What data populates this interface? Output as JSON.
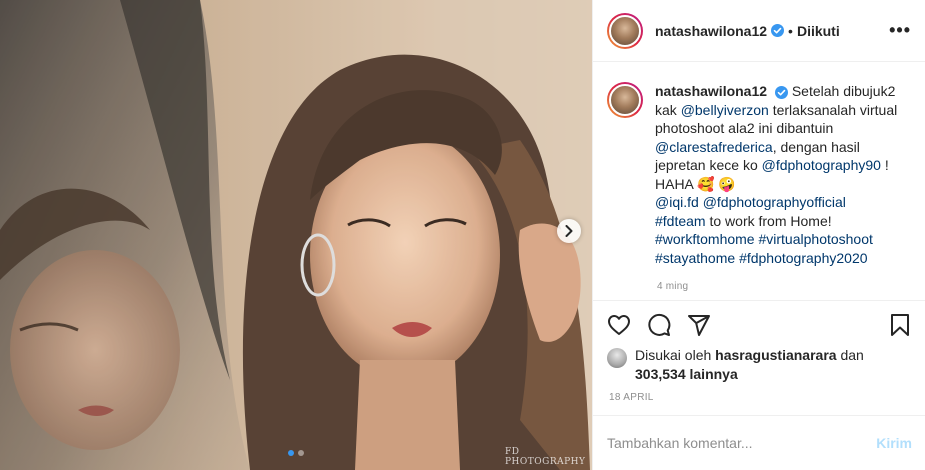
{
  "post": {
    "username": "natashawilona12",
    "follow_separator": "•",
    "follow_status": "Diikuti",
    "more_label": "•••",
    "caption": {
      "username": "natashawilona12",
      "seg1": " Setelah dibujuk2 kak ",
      "mention1": "@bellyiverzon",
      "seg2": " terlaksanalah virtual photoshoot ala2 ini dibantuin ",
      "mention2": "@clarestafrederica",
      "seg3": ", dengan hasil jepretan kece ko ",
      "mention3": "@fdphotography90",
      "seg4": " ! HAHA 🥰 🤪",
      "mention4": "@iqi.fd",
      "mention5": "@fdphotographyofficial",
      "hashtag1": "#fdteam",
      "seg5": " to work from Home!",
      "hashtag2": "#workftomhome",
      "hashtag3": "#virtualphotoshoot",
      "hashtag4": "#stayathome",
      "hashtag5": "#fdphotography2020",
      "time": "4 ming"
    },
    "likes": {
      "prefix": "Disukai oleh ",
      "user": "hasragustianarara",
      "middle": " dan ",
      "count": "303,534",
      "suffix": " lainnya"
    },
    "date": "18 APRIL",
    "comment": {
      "placeholder": "Tambahkan komentar...",
      "post_label": "Kirim"
    },
    "watermark": "FD PHOTOGRAPHY",
    "carousel": {
      "total": 2,
      "active": 1
    }
  },
  "icons": {
    "like": "heart-icon",
    "comment": "comment-icon",
    "share": "share-icon",
    "save": "bookmark-icon",
    "verified": "verified-badge-icon",
    "next": "chevron-right-icon"
  },
  "colors": {
    "link": "#00376b",
    "verified": "#3897f0",
    "muted": "#8e8e8e",
    "post_disabled": "#b2dffc"
  }
}
